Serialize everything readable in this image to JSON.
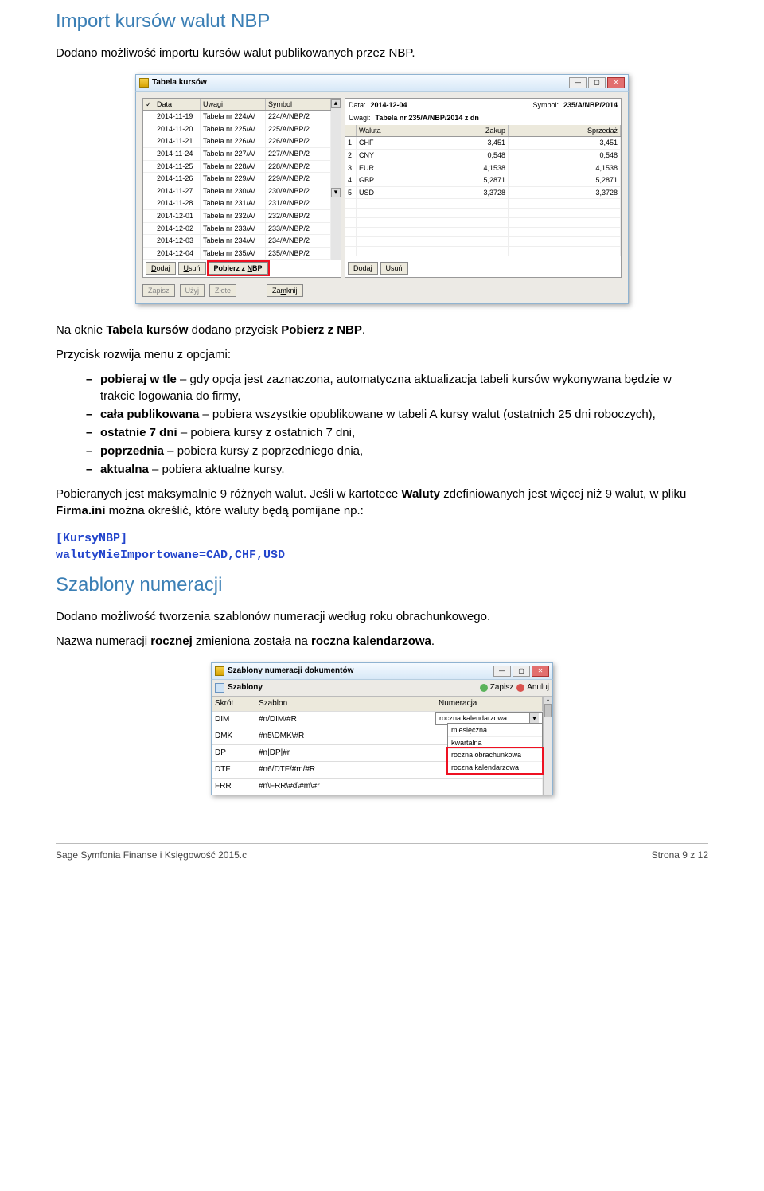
{
  "headings": {
    "h1": "Import kursów walut NBP",
    "h2": "Szablony numeracji"
  },
  "paragraphs": {
    "p1": "Dodano możliwość importu kursów walut publikowanych przez NBP.",
    "p2_pre": "Na oknie ",
    "p2_b1": "Tabela kursów",
    "p2_mid": " dodano przycisk ",
    "p2_b2": "Pobierz z NBP",
    "p2_post": ".",
    "p3": "Przycisk rozwija menu z opcjami:",
    "p4_pre": "Pobieranych jest maksymalnie 9 różnych walut. Jeśli w kartotece ",
    "p4_b1": "Waluty",
    "p4_mid": " zdefiniowanych jest więcej niż 9 walut, w pliku ",
    "p4_b2": "Firma.ini",
    "p4_post": " można określić, które waluty będą pomijane np.:",
    "p5": "Dodano możliwość tworzenia szablonów numeracji według roku obrachunkowego.",
    "p6_pre": "Nazwa numeracji ",
    "p6_b1": "rocznej",
    "p6_mid": " zmieniona została na ",
    "p6_b2": "roczna kalendarzowa",
    "p6_post": "."
  },
  "bullets": {
    "b1_b": "pobieraj w tle",
    "b1_rest": " – gdy opcja jest zaznaczona, automatyczna aktualizacja tabeli kursów wykonywana będzie w trakcie logowania do firmy,",
    "b2_b": "cała publikowana",
    "b2_rest": " – pobiera wszystkie opublikowane w tabeli A kursy walut (ostatnich 25 dni roboczych),",
    "b3_b": "ostatnie 7 dni",
    "b3_rest": " – pobiera kursy z ostatnich 7 dni,",
    "b4_b": "poprzednia",
    "b4_rest": " – pobiera kursy z poprzedniego dnia,",
    "b5_b": "aktualna",
    "b5_rest": " – pobiera aktualne kursy."
  },
  "code": {
    "l1": "[KursyNBP]",
    "l2": "walutyNieImportowane=CAD,CHF,USD"
  },
  "kursy_window": {
    "title": "Tabela kursów",
    "left_headers": [
      "Data",
      "Uwagi",
      "Symbol"
    ],
    "left_rows": [
      [
        "2014-11-19",
        "Tabela nr 224/A/",
        "224/A/NBP/2"
      ],
      [
        "2014-11-20",
        "Tabela nr 225/A/",
        "225/A/NBP/2"
      ],
      [
        "2014-11-21",
        "Tabela nr 226/A/",
        "226/A/NBP/2"
      ],
      [
        "2014-11-24",
        "Tabela nr 227/A/",
        "227/A/NBP/2"
      ],
      [
        "2014-11-25",
        "Tabela nr 228/A/",
        "228/A/NBP/2"
      ],
      [
        "2014-11-26",
        "Tabela nr 229/A/",
        "229/A/NBP/2"
      ],
      [
        "2014-11-27",
        "Tabela nr 230/A/",
        "230/A/NBP/2"
      ],
      [
        "2014-11-28",
        "Tabela nr 231/A/",
        "231/A/NBP/2"
      ],
      [
        "2014-12-01",
        "Tabela nr 232/A/",
        "232/A/NBP/2"
      ],
      [
        "2014-12-02",
        "Tabela nr 233/A/",
        "233/A/NBP/2"
      ],
      [
        "2014-12-03",
        "Tabela nr 234/A/",
        "234/A/NBP/2"
      ],
      [
        "2014-12-04",
        "Tabela nr 235/A/",
        "235/A/NBP/2"
      ]
    ],
    "left_btns": {
      "dodaj": "Dodaj",
      "usun": "Usuń",
      "pobierz": "Pobierz z NBP"
    },
    "right_detail": {
      "data_lab": "Data:",
      "data_val": "2014-12-04",
      "symbol_lab": "Symbol:",
      "symbol_val": "235/A/NBP/2014",
      "uwagi_lab": "Uwagi:",
      "uwagi_val": "Tabela nr 235/A/NBP/2014 z dn"
    },
    "right_headers": [
      "Waluta",
      "Zakup",
      "Sprzedaż"
    ],
    "right_rows": [
      [
        "1",
        "CHF",
        "3,451",
        "3,451"
      ],
      [
        "2",
        "CNY",
        "0,548",
        "0,548"
      ],
      [
        "3",
        "EUR",
        "4,1538",
        "4,1538"
      ],
      [
        "4",
        "GBP",
        "5,2871",
        "5,2871"
      ],
      [
        "5",
        "USD",
        "3,3728",
        "3,3728"
      ]
    ],
    "right_btns": {
      "dodaj": "Dodaj",
      "usun": "Usuń"
    },
    "footer_btns": {
      "zapisz": "Zapisz",
      "uzyj": "Użyj",
      "zlote": "Złote",
      "zamknij": "Zamknij"
    }
  },
  "szablony_window": {
    "title": "Szablony numeracji dokumentów",
    "toolbar": {
      "label": "Szablony",
      "zapisz": "Zapisz",
      "anuluj": "Anuluj"
    },
    "headers": [
      "Skrót",
      "Szablon",
      "Numeracja"
    ],
    "rows": [
      [
        "DIM",
        "#n/DIM/#R"
      ],
      [
        "DMK",
        "#n5\\DMK\\#R"
      ],
      [
        "DP",
        "#n|DP|#r"
      ],
      [
        "DTF",
        "#n6/DTF/#m/#R"
      ],
      [
        "FRR",
        "#n\\FRR\\#d\\#m\\#r"
      ]
    ],
    "dropdown": {
      "selected": "roczna kalendarzowa",
      "options": [
        "miesięczna",
        "kwartalna",
        "roczna obrachunkowa",
        "roczna kalendarzowa"
      ]
    }
  },
  "footer": {
    "left": "Sage Symfonia Finanse i Księgowość 2015.c",
    "right": "Strona 9 z 12"
  }
}
